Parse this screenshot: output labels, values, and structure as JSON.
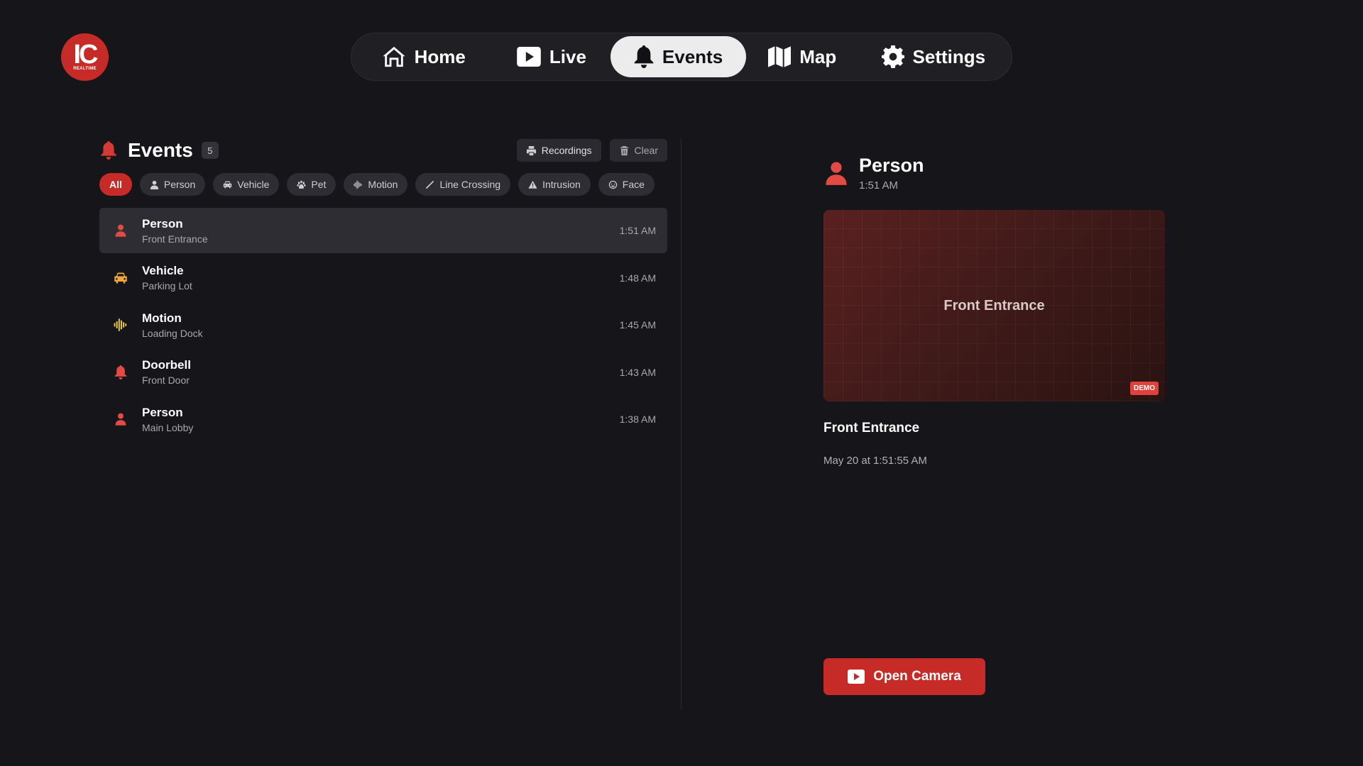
{
  "logo": {
    "text": "IC",
    "subtext": "REALTIME"
  },
  "nav": {
    "items": [
      {
        "label": "Home",
        "icon": "home-icon"
      },
      {
        "label": "Live",
        "icon": "play-icon"
      },
      {
        "label": "Events",
        "icon": "bell-icon",
        "active": true
      },
      {
        "label": "Map",
        "icon": "map-icon"
      },
      {
        "label": "Settings",
        "icon": "gear-icon"
      }
    ]
  },
  "events_panel": {
    "title": "Events",
    "count": "5",
    "recordings_label": "Recordings",
    "clear_label": "Clear",
    "filters": [
      {
        "label": "All",
        "active": true
      },
      {
        "label": "Person",
        "icon": "person-icon"
      },
      {
        "label": "Vehicle",
        "icon": "car-icon"
      },
      {
        "label": "Pet",
        "icon": "paw-icon"
      },
      {
        "label": "Motion",
        "icon": "waveform-icon"
      },
      {
        "label": "Line Crossing",
        "icon": "line-icon"
      },
      {
        "label": "Intrusion",
        "icon": "warning-icon"
      },
      {
        "label": "Face",
        "icon": "face-icon"
      }
    ],
    "events": [
      {
        "title": "Person",
        "location": "Front Entrance",
        "time": "1:51 AM",
        "icon": "person-icon",
        "color": "#e24a43",
        "selected": true
      },
      {
        "title": "Vehicle",
        "location": "Parking Lot",
        "time": "1:48 AM",
        "icon": "car-icon",
        "color": "#f0a63a"
      },
      {
        "title": "Motion",
        "location": "Loading Dock",
        "time": "1:45 AM",
        "icon": "waveform-icon",
        "color": "#f3d23a"
      },
      {
        "title": "Doorbell",
        "location": "Front Door",
        "time": "1:43 AM",
        "icon": "bell-icon",
        "color": "#e24a43"
      },
      {
        "title": "Person",
        "location": "Main Lobby",
        "time": "1:38 AM",
        "icon": "person-icon",
        "color": "#e24a43"
      }
    ]
  },
  "detail": {
    "title": "Person",
    "time": "1:51 AM",
    "preview_label": "Front Entrance",
    "demo_badge": "DEMO",
    "camera_name": "Front Entrance",
    "date": "May 20 at 1:51:55 AM",
    "open_camera_label": "Open Camera"
  },
  "colors": {
    "accent": "#c62b27",
    "background": "#15151a"
  }
}
